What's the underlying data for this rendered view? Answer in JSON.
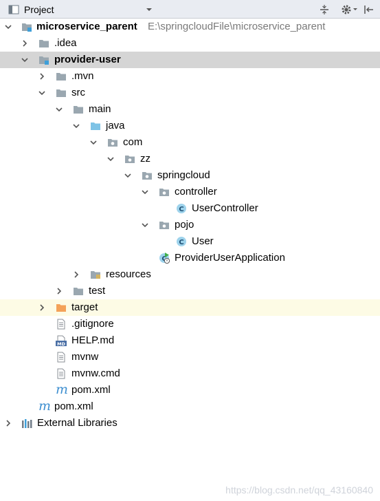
{
  "header": {
    "panel_title": "Project",
    "icons": [
      "project-view-icon",
      "dropdown-chevron-icon",
      "collapse-all-icon",
      "settings-gear-icon",
      "hide-panel-icon"
    ]
  },
  "tree": {
    "root_name": "microservice_parent",
    "root_path": "E:\\springcloudFile\\microservice_parent",
    "idea": ".idea",
    "module_name": "provider-user",
    "mvn": ".mvn",
    "src": "src",
    "main": "main",
    "java": "java",
    "com": "com",
    "zz": "zz",
    "springcloud": "springcloud",
    "controller": "controller",
    "user_controller": "UserController",
    "pojo": "pojo",
    "user": "User",
    "app": "ProviderUserApplication",
    "resources": "resources",
    "test": "test",
    "target": "target",
    "gitignore": ".gitignore",
    "help_md": "HELP.md",
    "mvnw": "mvnw",
    "mvnw_cmd": "mvnw.cmd",
    "module_pom": "pom.xml",
    "root_pom": "pom.xml",
    "external_libraries": "External Libraries"
  },
  "icon_badges": {
    "class_letter": "C",
    "md_badge": "MD",
    "maven_letter": "m"
  },
  "watermark": "https://blog.csdn.net/qq_43160840",
  "colors": {
    "header_bg": "#e9ecf2",
    "selected_row": "#d5d5d5",
    "target_row": "#fdfbe5",
    "folder_gray": "#9aa7b0",
    "source_folder_blue": "#7ec3e6",
    "target_folder_orange": "#f4a259",
    "class_circle": "#9ed3ec",
    "maven_blue": "#3e8fd0",
    "path_gray": "#7a7a7a"
  }
}
